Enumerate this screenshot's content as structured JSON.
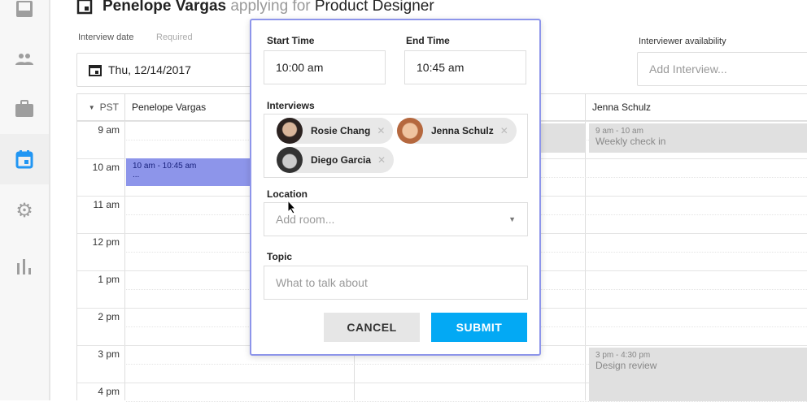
{
  "sidebar": {
    "items": [
      {
        "icon": "inbox-icon"
      },
      {
        "icon": "people-icon"
      },
      {
        "icon": "briefcase-icon"
      },
      {
        "icon": "calendar-icon",
        "selected": true
      },
      {
        "icon": "gear-icon"
      },
      {
        "icon": "bar-chart-icon"
      }
    ]
  },
  "header": {
    "candidate": "Penelope Vargas",
    "applying": "applying for",
    "role": "Product Designer"
  },
  "date": {
    "label": "Interview date",
    "required": "Required",
    "value": "Thu, 12/14/2017"
  },
  "availability": {
    "label": "Interviewer availability",
    "placeholder": "Add Interview..."
  },
  "calendar": {
    "timezone": "PST",
    "columns": [
      "Penelope Vargas",
      "",
      "Jenna Schulz"
    ],
    "hours": [
      "9 am",
      "10 am",
      "11 am",
      "12 pm",
      "1 pm",
      "2 pm",
      "3 pm",
      "4 pm"
    ],
    "events": [
      {
        "time": "10 am - 10:45 am",
        "title": "..."
      },
      {
        "time": "9 am - 10 am",
        "title": "Weekly check in"
      },
      {
        "time": "3 pm - 4:30 pm",
        "title": "Design review"
      }
    ]
  },
  "popup": {
    "start_label": "Start Time",
    "start_value": "10:00 am",
    "end_label": "End Time",
    "end_value": "10:45 am",
    "interviews_label": "Interviews",
    "interviewers": [
      "Rosie Chang",
      "Jenna Schulz",
      "Diego Garcia"
    ],
    "remove": "✕",
    "location_label": "Location",
    "location_placeholder": "Add room...",
    "topic_label": "Topic",
    "topic_placeholder": "What to talk about",
    "cancel": "CANCEL",
    "submit": "SUBMIT"
  },
  "colors": {
    "accent": "#03a9f4",
    "event_selected": "#8d95ea",
    "event_busy": "#e0e0e0"
  }
}
